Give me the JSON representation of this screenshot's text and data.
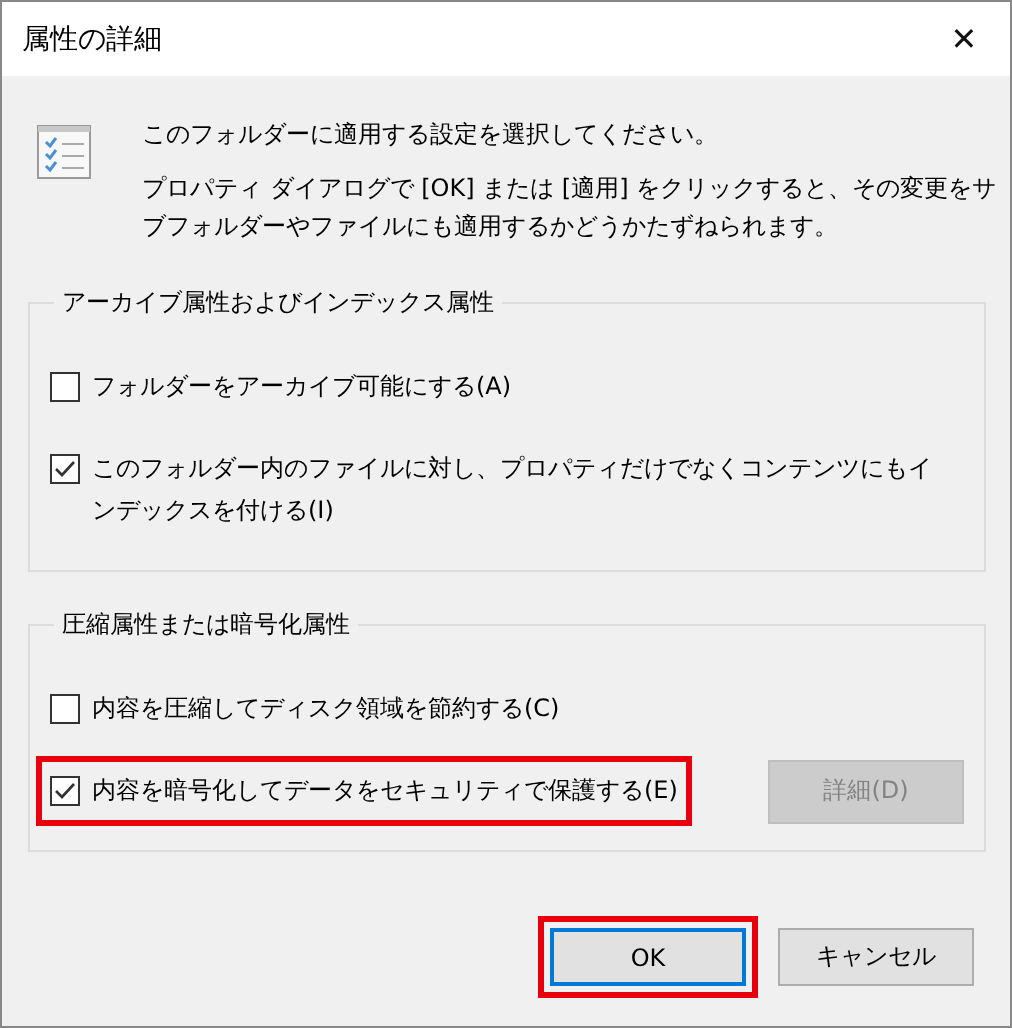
{
  "window": {
    "title": "属性の詳細",
    "close": "✕"
  },
  "intro": {
    "lines": [
      "このフォルダーに適用する設定を選択してください。",
      "プロパティ ダイアログで [OK] または [適用] をクリックすると、その変更をサブフォルダーやファイルにも適用するかどうかたずねられます。"
    ]
  },
  "groups": [
    {
      "title": "アーカイブ属性およびインデックス属性",
      "items": [
        {
          "label": "フォルダーをアーカイブ可能にする(A)",
          "checked": false,
          "highlighted": false
        },
        {
          "label": "このフォルダー内のファイルに対し、プロパティだけでなくコンテンツにもインデックスを付ける(I)",
          "checked": true,
          "highlighted": false
        }
      ]
    },
    {
      "title": "圧縮属性または暗号化属性",
      "items": [
        {
          "label": "内容を圧縮してディスク領域を節約する(C)",
          "checked": false,
          "highlighted": false
        },
        {
          "label": "内容を暗号化してデータをセキュリティで保護する(E)",
          "checked": true,
          "highlighted": true
        }
      ],
      "button": {
        "label": "詳細(D)",
        "disabled": true
      }
    }
  ],
  "buttons": [
    {
      "label": "OK",
      "default": true,
      "highlighted": true
    },
    {
      "label": "キャンセル",
      "default": false,
      "highlighted": false
    }
  ]
}
